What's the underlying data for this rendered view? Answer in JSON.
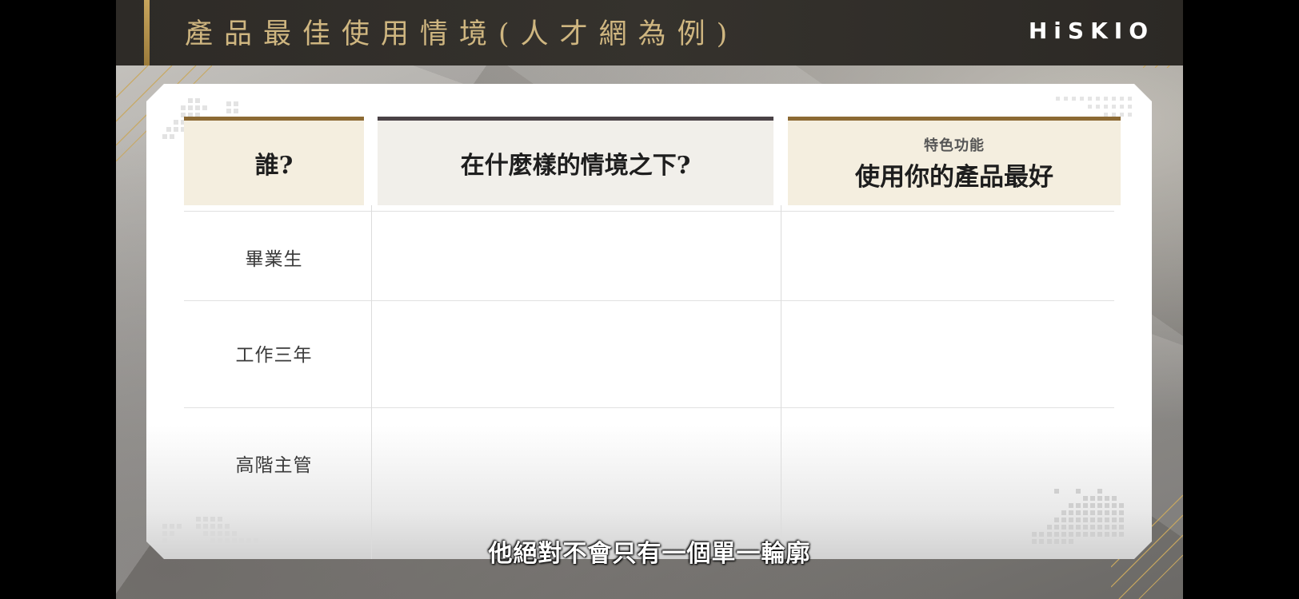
{
  "slide": {
    "title": "產品最佳使用情境(人才網為例)",
    "logo": "HiSKIO"
  },
  "table": {
    "headers": {
      "who": "誰?",
      "situation": "在什麼樣的情境之下?",
      "feature_sub": "特色功能",
      "feature": "使用你的產品最好"
    },
    "rows": [
      {
        "who": "畢業生",
        "situation": "",
        "feature": ""
      },
      {
        "who": "工作三年",
        "situation": "",
        "feature": ""
      },
      {
        "who": "高階主管",
        "situation": "",
        "feature": ""
      }
    ]
  },
  "subtitle": "他絕對不會只有一個單一輪廓",
  "colors": {
    "title_gold": "#cfb680",
    "header_brown": "#8c6a34",
    "header_dark": "#4a4246",
    "header_fill": "#f4eedf"
  }
}
